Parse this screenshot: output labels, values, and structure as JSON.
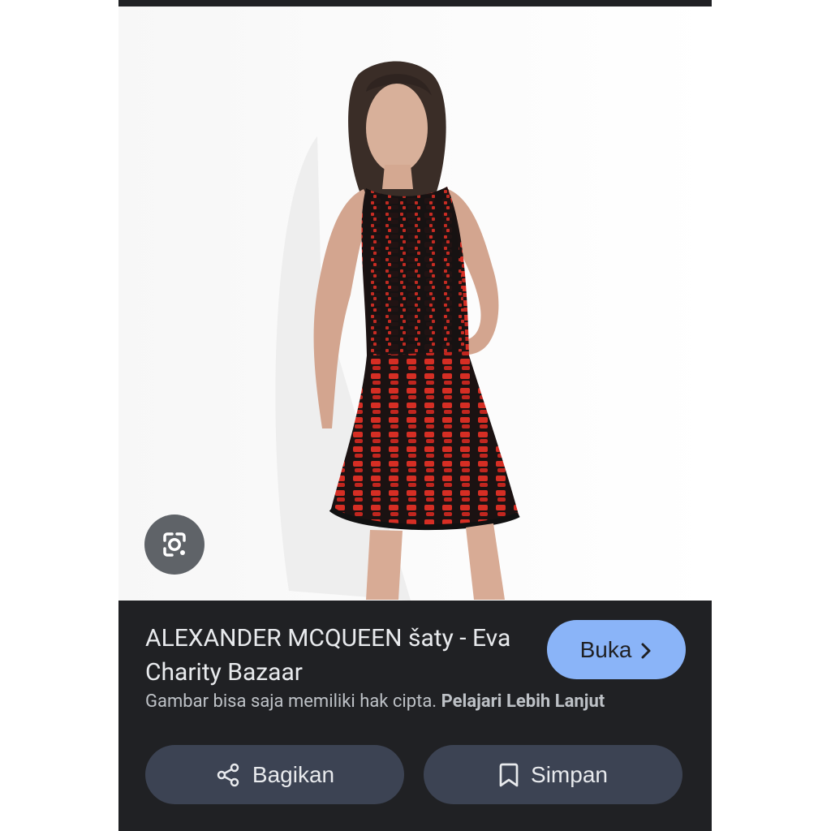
{
  "result": {
    "title": "ALEXANDER MCQUEEN šaty - Eva Charity Bazaar",
    "open_label": "Buka",
    "notice_text": "Gambar bisa saja memiliki hak cipta.",
    "learn_more_label": "Pelajari Lebih Lanjut"
  },
  "actions": {
    "share_label": "Bagikan",
    "save_label": "Simpan"
  },
  "icons": {
    "lens": "lens-icon",
    "open": "chevron-right-icon",
    "share": "share-icon",
    "save": "bookmark-icon"
  },
  "colors": {
    "panel_bg": "#202124",
    "open_button_bg": "#8ab4f8",
    "action_button_bg": "#3c4353",
    "text_primary": "#e8eaed",
    "text_secondary": "#bdc1c6"
  }
}
